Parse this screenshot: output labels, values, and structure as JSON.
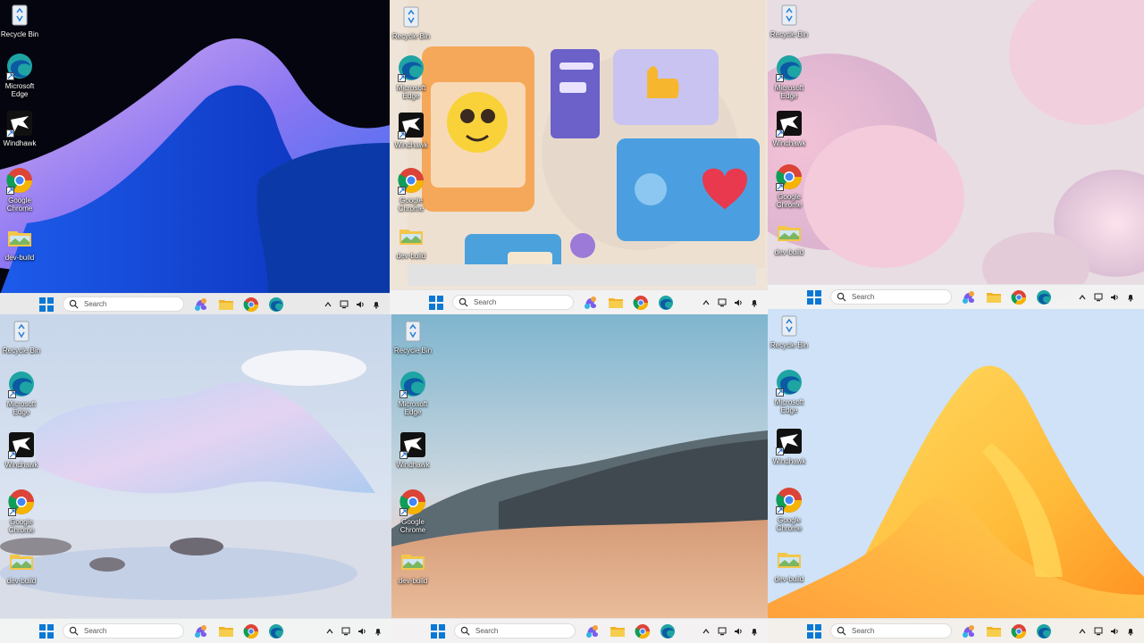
{
  "desktop_icons": {
    "recycle_bin": "Recycle Bin",
    "edge": "Microsoft Edge",
    "windhawk": "Windhawk",
    "chrome": "Google Chrome",
    "folder": "dev-build"
  },
  "taskbar": {
    "search_placeholder": "Search"
  },
  "panes": [
    {
      "wallpaper": "Windows 11 blue ribbon bloom on dark background"
    },
    {
      "wallpaper": "3D emoji app tiles"
    },
    {
      "wallpaper": "pastel pink glass bloom"
    },
    {
      "wallpaper": "glass sculpture over lake"
    },
    {
      "wallpaper": "desert dunes and mountain"
    },
    {
      "wallpaper": "orange yellow ribbon on light blue"
    }
  ],
  "colors": {
    "start_blue": "#0a78d4",
    "taskbar_bg": "#f3f3f3"
  }
}
